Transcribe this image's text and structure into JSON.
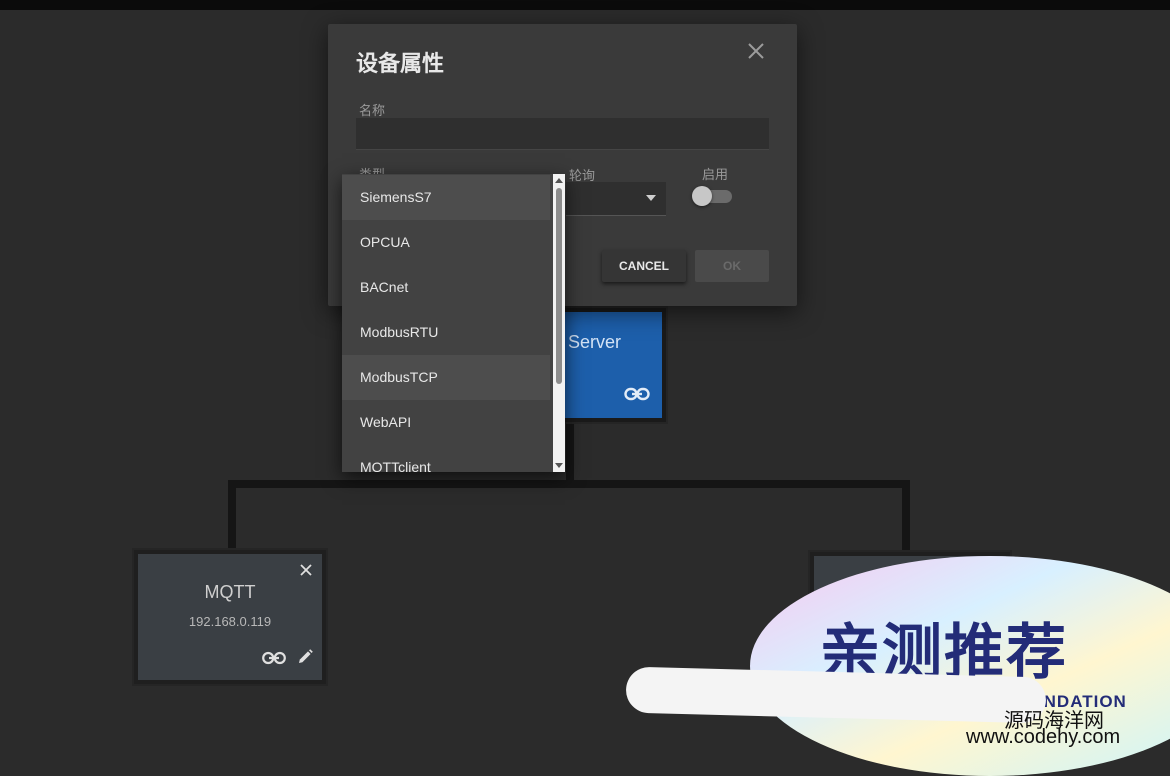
{
  "dialog": {
    "title": "设备属性",
    "name_label": "名称",
    "name_value": "",
    "type_label": "类型",
    "poll_label": "轮询",
    "enable_label": "启用",
    "enable_on": false,
    "cancel_label": "CANCEL",
    "ok_label": "OK"
  },
  "type_dropdown": {
    "items": [
      "SiemensS7",
      "OPCUA",
      "BACnet",
      "ModbusRTU",
      "ModbusTCP",
      "WebAPI",
      "MQTTclient"
    ],
    "highlighted": [
      "SiemensS7",
      "ModbusTCP"
    ]
  },
  "cards": {
    "server_title": "Server",
    "mqtt_title": "MQTT",
    "mqtt_ip": "192.168.0.119"
  },
  "watermark": {
    "cn_text": "亲测推荐",
    "en_text": "PERSONAL RECOMMENDATION",
    "site_name": "源码海洋网",
    "site_url": "www.codehy.com"
  },
  "colors": {
    "background": "#2b2b2b",
    "dialog": "#3a3a3a",
    "server_card": "#1d5fab",
    "dropdown": "#424242"
  }
}
